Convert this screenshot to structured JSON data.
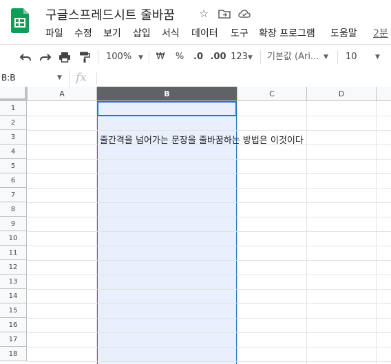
{
  "title_bar": {
    "doc_title": "구글스프레드시트 줄바꿈",
    "star_icon": "star-outline-icon",
    "move_icon": "folder-move-icon",
    "cloud_icon": "cloud-saved-icon"
  },
  "menu": {
    "items": [
      "파일",
      "수정",
      "보기",
      "삽입",
      "서식",
      "데이터",
      "도구",
      "확장 프로그램",
      "도움말"
    ],
    "last_edit": "2분"
  },
  "toolbar": {
    "zoom": "100%",
    "currency": "₩",
    "percent": "%",
    "decrease_decimal": ".0",
    "increase_decimal": ".00",
    "number_format": "123",
    "font": "기본값 (Ari...",
    "font_size": "10"
  },
  "formula_bar": {
    "name_box": "B:B",
    "fx": "fx",
    "value": ""
  },
  "grid": {
    "columns": [
      "A",
      "B",
      "C",
      "D"
    ],
    "selected_column": "B",
    "rows": [
      "1",
      "2",
      "3",
      "4",
      "5",
      "6",
      "7",
      "8",
      "9",
      "10",
      "11",
      "12",
      "13",
      "14",
      "15",
      "16",
      "17",
      "18"
    ],
    "cells": {
      "B3": "줄간격을 넘어가는 문장을 줄바꿈하는 방법은 이것이다"
    }
  },
  "colors": {
    "brand_green": "#0f9d58",
    "selection_blue": "#1a73e8",
    "selection_fill": "#e8f0fd"
  }
}
